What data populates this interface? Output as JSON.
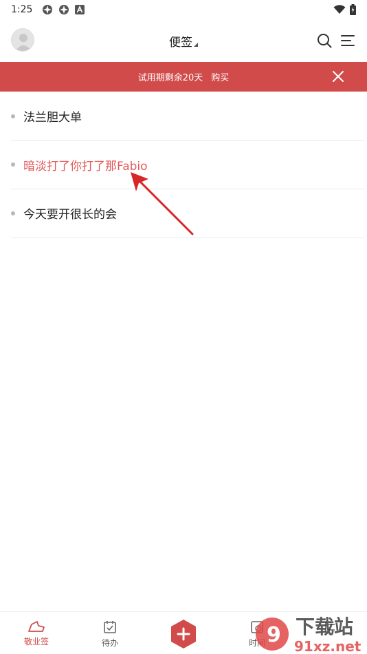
{
  "status_bar": {
    "time": "1:25"
  },
  "header": {
    "title": "便签",
    "avatar_icon": "avatar-icon",
    "search_icon": "search-icon",
    "menu_icon": "menu-icon"
  },
  "banner": {
    "text": "试用期剩余20天",
    "buy_label": "购买",
    "close_icon": "close-icon",
    "color": "#d14b4b"
  },
  "notes": [
    {
      "text": "法兰胆大单"
    },
    {
      "text": "暗淡打了你打了那Fabio"
    },
    {
      "text": "今天要开很长的会"
    }
  ],
  "colors": {
    "accent": "#d14b4b",
    "highlight_text": "#e35a5a"
  },
  "bottom_nav": {
    "items": [
      {
        "label": "敬业签",
        "icon": "note-hat-icon",
        "active": true
      },
      {
        "label": "待办",
        "icon": "calendar-check-icon",
        "active": false
      },
      {
        "label": "",
        "icon": "plus-hexagon-icon",
        "active": false
      },
      {
        "label": "时间",
        "icon": "clock-icon",
        "active": false
      },
      {
        "label": "",
        "icon": "timeline-icon",
        "active": false
      }
    ]
  },
  "watermark": {
    "text_cn": "下载站",
    "text_en": "91xz.net"
  }
}
